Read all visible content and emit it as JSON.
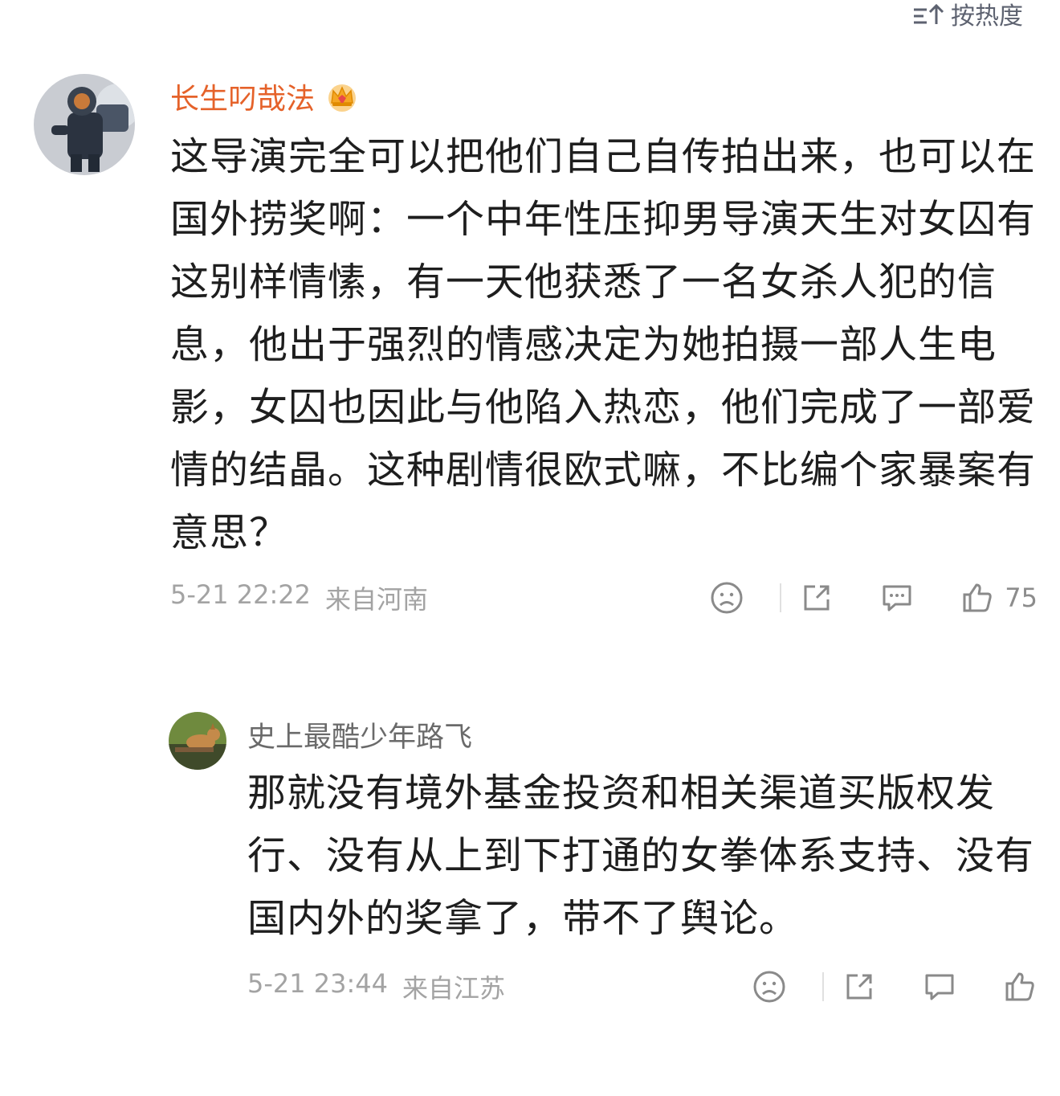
{
  "sort": {
    "label": "按热度"
  },
  "comments": [
    {
      "username": "长生叼哉法",
      "text": "这导演完全可以把他们自己自传拍出来，也可以在国外捞奖啊：一个中年性压抑男导演天生对女囚有这别样情愫，有一天他获悉了一名女杀人犯的信息，他出于强烈的情感决定为她拍摄一部人生电影，女囚也因此与他陷入热恋，他们完成了一部爱情的结晶。这种剧情很欧式嘛，不比编个家暴案有意思？",
      "time": "5-21 22:22",
      "location": "来自河南",
      "likes": "75"
    },
    {
      "username": "史上最酷少年路飞",
      "text": "那就没有境外基金投资和相关渠道买版权发行、没有从上到下打通的女拳体系支持、没有国内外的奖拿了，带不了舆论。",
      "time": "5-21 23:44",
      "location": "来自江苏"
    }
  ],
  "colors": {
    "username_vip": "#e5622a",
    "meta": "#a3a3a3",
    "text": "#1e1e1e"
  }
}
